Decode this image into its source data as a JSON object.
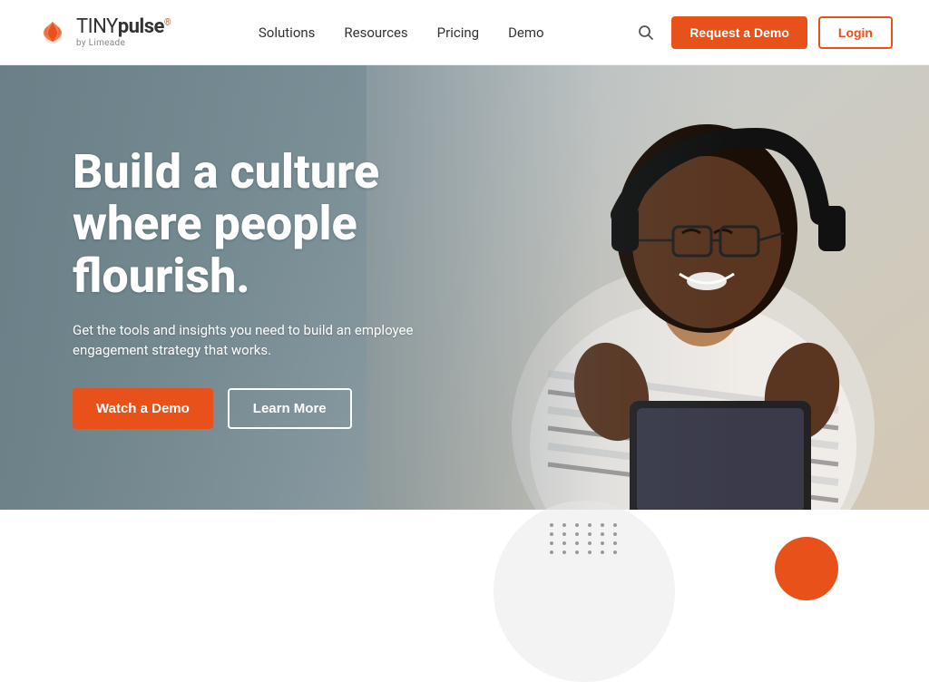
{
  "header": {
    "logo": {
      "brand_tiny": "TINY",
      "brand_pulse": "pulse",
      "brand_reg": "®",
      "by_text": "by Limeade"
    },
    "nav": {
      "items": [
        {
          "label": "Solutions",
          "id": "solutions"
        },
        {
          "label": "Resources",
          "id": "resources"
        },
        {
          "label": "Pricing",
          "id": "pricing"
        },
        {
          "label": "Demo",
          "id": "demo"
        }
      ]
    },
    "actions": {
      "request_demo_label": "Request a Demo",
      "login_label": "Login"
    }
  },
  "hero": {
    "headline": "Build a culture where people flourish.",
    "subtext": "Get the tools and insights you need to build an employee engagement strategy that works.",
    "watch_demo_label": "Watch a Demo",
    "learn_more_label": "Learn More"
  },
  "colors": {
    "orange": "#e8511a",
    "white": "#ffffff",
    "dark": "#333333"
  }
}
